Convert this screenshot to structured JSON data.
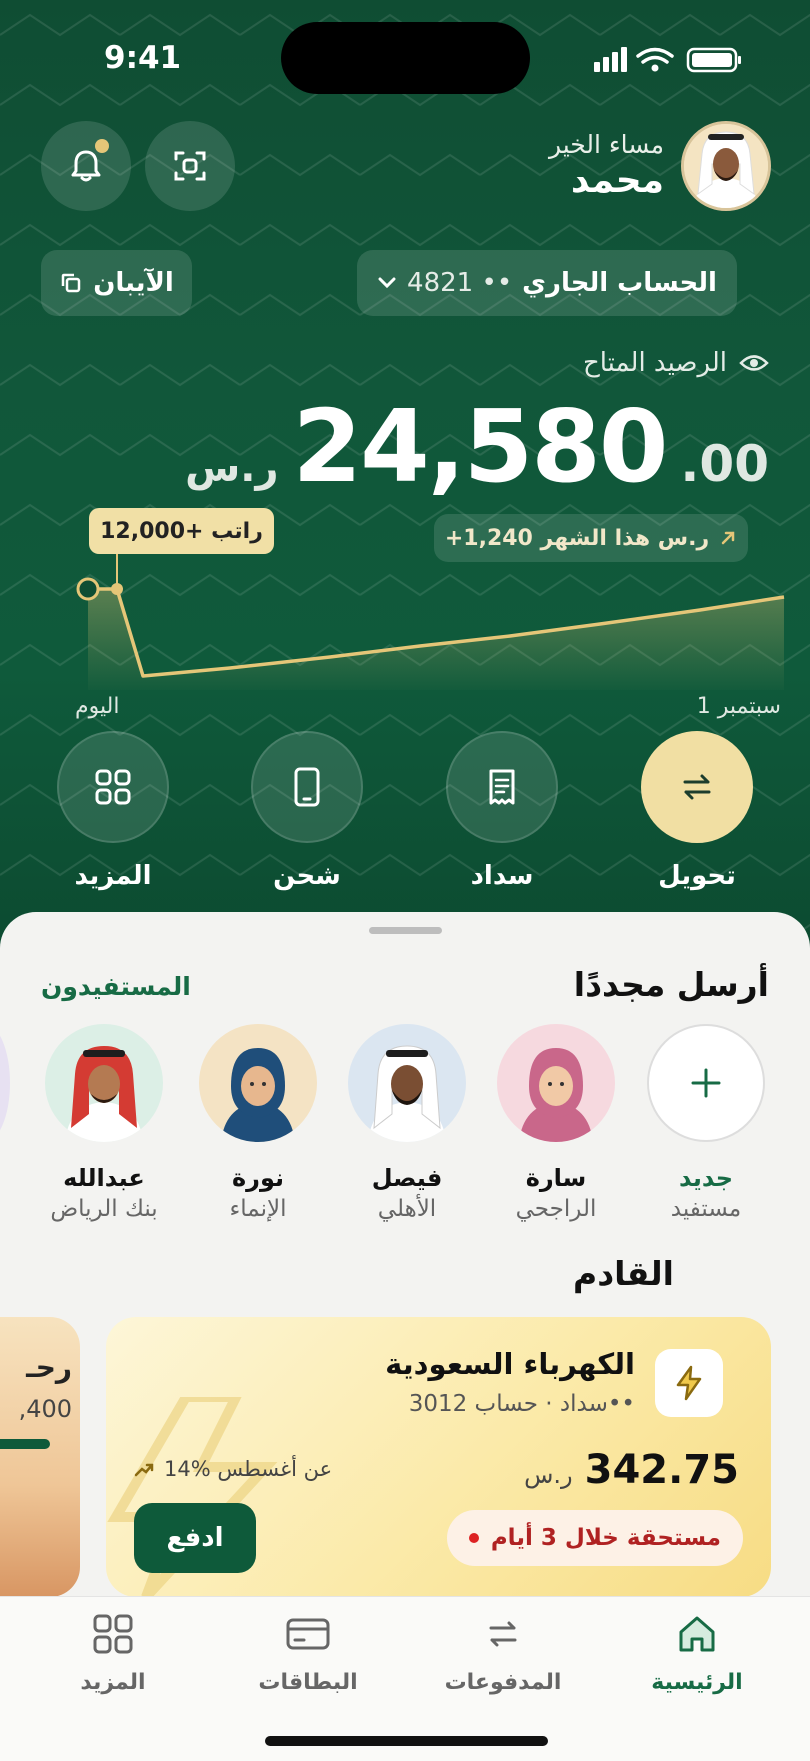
{
  "status": {
    "time": "9:41"
  },
  "header": {
    "greeting": "مساء الخير",
    "user_name": "محمد",
    "account_label": "الحساب الجاري",
    "account_mask": "4821 ••",
    "iban_label": "الآيبان"
  },
  "balance": {
    "label": "الرصيد المتاح",
    "currency": "ر.س",
    "integer": "24,580",
    "decimal": ".00",
    "month_change": "+1,240 ر.س هذا الشهر",
    "salary_tag": "راتب +12,000"
  },
  "chart_labels": {
    "start": "1 سبتمبر",
    "end": "اليوم"
  },
  "actions": [
    {
      "label": "تحويل",
      "icon": "transfer-icon"
    },
    {
      "label": "سداد",
      "icon": "bill-icon"
    },
    {
      "label": "شحن",
      "icon": "phone-icon"
    },
    {
      "label": "المزيد",
      "icon": "grid-icon"
    }
  ],
  "send_again": {
    "title": "أرسل مجددًا",
    "link": "المستفيدون",
    "new_beneficiary": {
      "line1": "جديد",
      "line2": "مستفيد"
    },
    "contacts": [
      {
        "name": "سارة",
        "bank": "الراجحي"
      },
      {
        "name": "فيصل",
        "bank": "الأهلي"
      },
      {
        "name": "نورة",
        "bank": "الإنماء"
      },
      {
        "name": "عبدالله",
        "bank": "بنك الرياض"
      }
    ]
  },
  "upcoming": {
    "title": "القادم",
    "bill": {
      "title": "الكهرباء السعودية",
      "subtitle": "سداد · حساب 3012••",
      "amount": "342.75",
      "currency": "ر.س",
      "trend": "14% عن أغسطس",
      "due": "مستحقة خلال 3 أيام",
      "pay_label": "ادفع"
    },
    "side_card": {
      "title": "رحـ",
      "amount": ",400"
    }
  },
  "tabs": [
    {
      "label": "الرئيسية",
      "icon": "home-icon",
      "active": true
    },
    {
      "label": "المدفوعات",
      "icon": "transfer-icon"
    },
    {
      "label": "البطاقات",
      "icon": "card-icon"
    },
    {
      "label": "المزيد",
      "icon": "grid-icon"
    }
  ],
  "colors": {
    "primary": "#0f5a3b",
    "gold": "#f1dfa3",
    "danger": "#b02222"
  }
}
